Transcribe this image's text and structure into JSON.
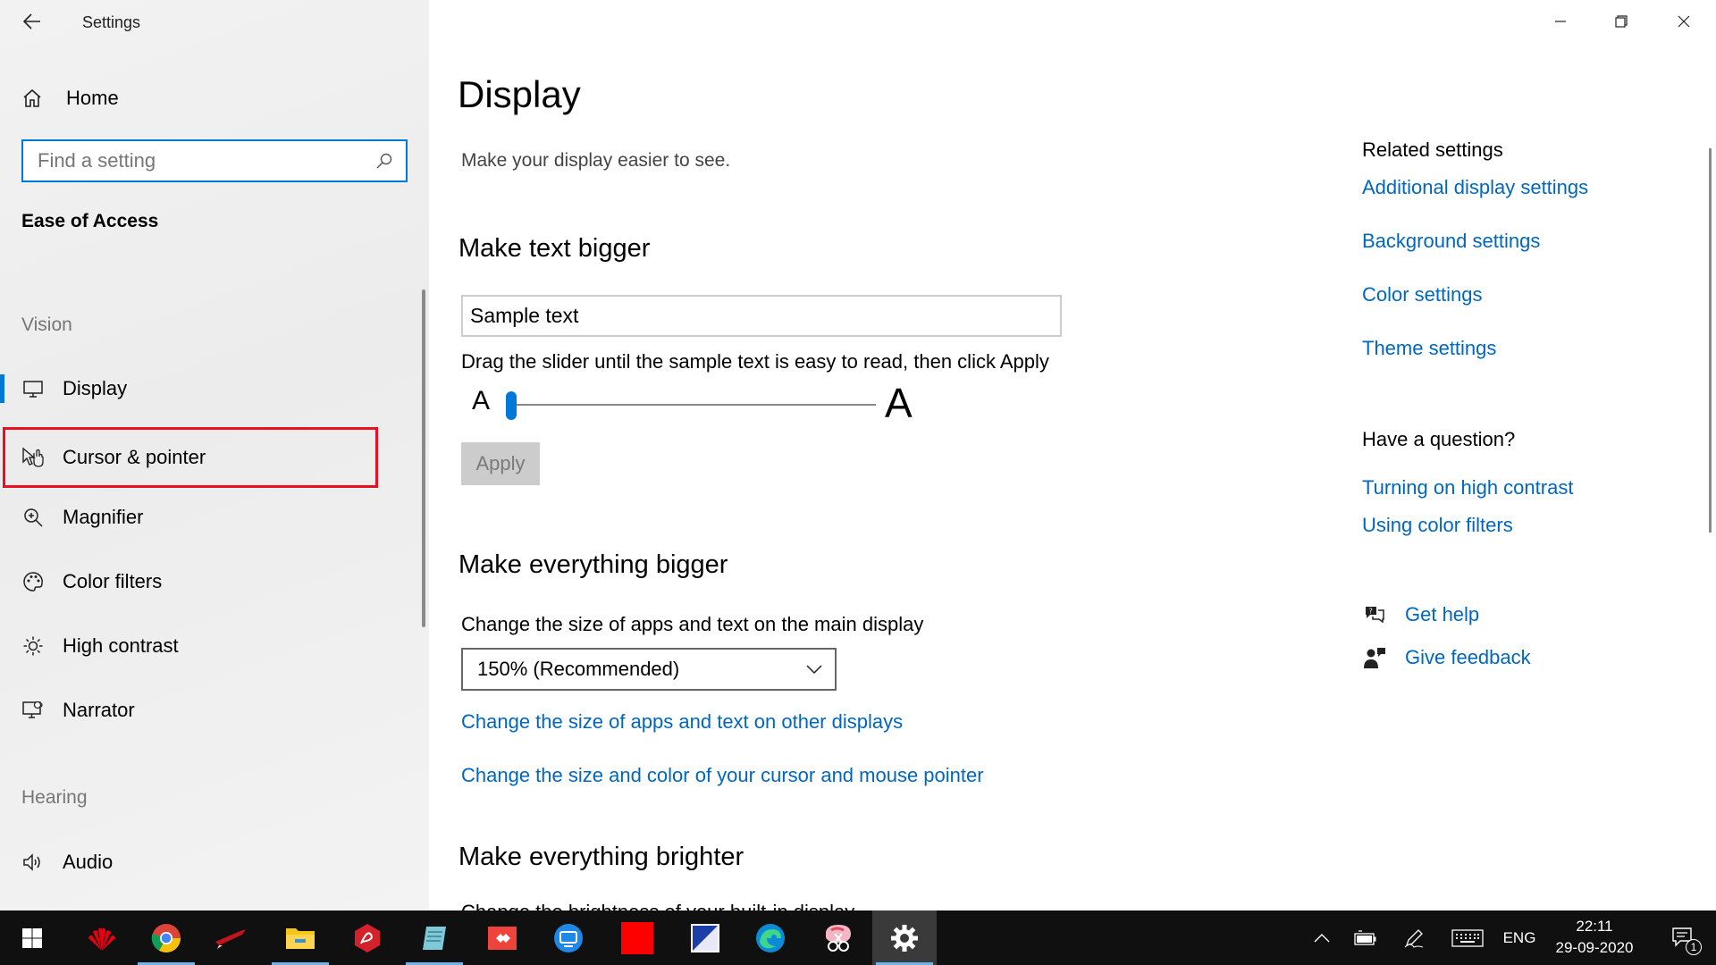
{
  "window": {
    "title": "Settings",
    "controls": {
      "minimize": "minimize-icon",
      "restore": "restore-icon",
      "close": "close-icon"
    }
  },
  "sidebar": {
    "home_label": "Home",
    "search_placeholder": "Find a setting",
    "section_title": "Ease of Access",
    "groups": {
      "vision": "Vision",
      "hearing": "Hearing"
    },
    "items": [
      {
        "label": "Display",
        "icon": "monitor-icon",
        "selected": true
      },
      {
        "label": "Cursor & pointer",
        "icon": "cursor-pointer-icon",
        "highlighted": true
      },
      {
        "label": "Magnifier",
        "icon": "magnifier-icon"
      },
      {
        "label": "Color filters",
        "icon": "palette-icon"
      },
      {
        "label": "High contrast",
        "icon": "brightness-icon"
      },
      {
        "label": "Narrator",
        "icon": "narrator-icon"
      },
      {
        "label": "Audio",
        "icon": "speaker-icon"
      }
    ]
  },
  "main": {
    "title": "Display",
    "subtitle": "Make your display easier to see.",
    "text_bigger": {
      "heading": "Make text bigger",
      "sample": "Sample text",
      "instruction": "Drag the slider until the sample text is easy to read, then click Apply",
      "slider_min_label": "A",
      "slider_max_label": "A",
      "slider_value": 0.0,
      "apply_label": "Apply"
    },
    "everything_bigger": {
      "heading": "Make everything bigger",
      "label": "Change the size of apps and text on the main display",
      "selected_option": "150% (Recommended)",
      "link_other_displays": "Change the size of apps and text on other displays",
      "link_cursor": "Change the size and color of your cursor and mouse pointer"
    },
    "everything_brighter": {
      "heading": "Make everything brighter",
      "partial_text": "Change the brightness of your built-in display"
    }
  },
  "related": {
    "heading": "Related settings",
    "links": [
      "Additional display settings",
      "Background settings",
      "Color settings",
      "Theme settings"
    ],
    "question_heading": "Have a question?",
    "question_links": [
      "Turning on high contrast",
      "Using color filters"
    ],
    "get_help": "Get help",
    "give_feedback": "Give feedback"
  },
  "taskbar": {
    "apps": [
      {
        "name": "huawei-icon",
        "color": "#e60012"
      },
      {
        "name": "chrome-icon",
        "color": "#4285f4",
        "running": true
      },
      {
        "name": "red-app-icon",
        "color": "#c4151c"
      },
      {
        "name": "file-explorer-icon",
        "color": "#f5c518",
        "running": true
      },
      {
        "name": "acrobat-icon",
        "color": "#d4222a"
      },
      {
        "name": "notepad-icon",
        "color": "#7fc8d8",
        "running": true
      },
      {
        "name": "anydesk-icon",
        "color": "#ef443b"
      },
      {
        "name": "blue-app-icon",
        "color": "#1e88e5"
      },
      {
        "name": "red-square-icon",
        "color": "#ff0000"
      },
      {
        "name": "paint-icon",
        "color": "#1b3ea8"
      },
      {
        "name": "edge-icon",
        "color": "#0c8ad6"
      },
      {
        "name": "snip-sketch-icon",
        "color": "#e14c5f"
      },
      {
        "name": "settings-gear-icon",
        "color": "#ffffff",
        "active": true
      }
    ],
    "tray": {
      "language": "ENG",
      "time": "22:11",
      "date": "29-09-2020",
      "notification_count": "1"
    }
  },
  "colors": {
    "accent": "#0078d7",
    "link": "#0067c0",
    "highlight_box": "#e81123"
  }
}
